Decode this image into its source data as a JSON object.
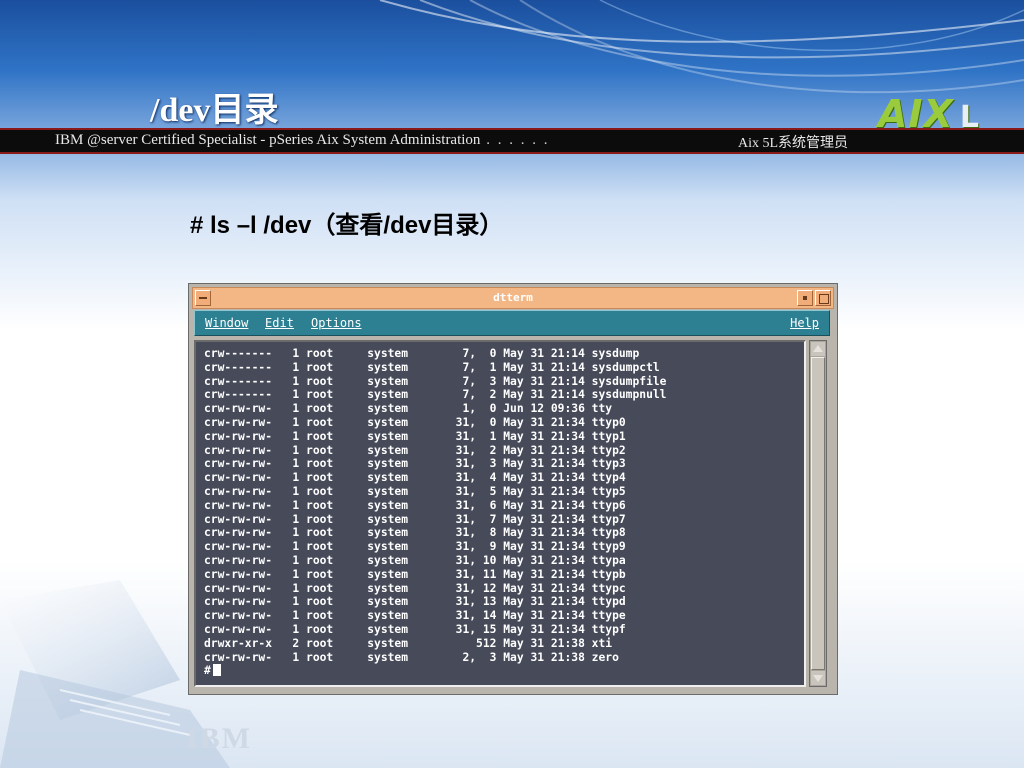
{
  "slide": {
    "title": "/dev目录",
    "banner_left": "IBM @server Certified Specialist - pSeries Aix System Administration",
    "banner_dots": " . . . . . .",
    "banner_right": "Aix 5L系统管理员",
    "logo_text": "AIX",
    "logo_suffix": "L",
    "command_heading": "# ls –l /dev（查看/dev目录）",
    "watermark": "IBM"
  },
  "window": {
    "title": "dtterm",
    "menu": {
      "window": "Window",
      "edit": "Edit",
      "options": "Options",
      "help": "Help"
    },
    "icons": {
      "window_menu": "window-menu-icon",
      "minimize": "minimize-icon",
      "maximize": "maximize-icon"
    }
  },
  "terminal": {
    "lines": [
      "crw-------   1 root     system        7,  0 May 31 21:14 sysdump",
      "crw-------   1 root     system        7,  1 May 31 21:14 sysdumpctl",
      "crw-------   1 root     system        7,  3 May 31 21:14 sysdumpfile",
      "crw-------   1 root     system        7,  2 May 31 21:14 sysdumpnull",
      "crw-rw-rw-   1 root     system        1,  0 Jun 12 09:36 tty",
      "crw-rw-rw-   1 root     system       31,  0 May 31 21:34 ttyp0",
      "crw-rw-rw-   1 root     system       31,  1 May 31 21:34 ttyp1",
      "crw-rw-rw-   1 root     system       31,  2 May 31 21:34 ttyp2",
      "crw-rw-rw-   1 root     system       31,  3 May 31 21:34 ttyp3",
      "crw-rw-rw-   1 root     system       31,  4 May 31 21:34 ttyp4",
      "crw-rw-rw-   1 root     system       31,  5 May 31 21:34 ttyp5",
      "crw-rw-rw-   1 root     system       31,  6 May 31 21:34 ttyp6",
      "crw-rw-rw-   1 root     system       31,  7 May 31 21:34 ttyp7",
      "crw-rw-rw-   1 root     system       31,  8 May 31 21:34 ttyp8",
      "crw-rw-rw-   1 root     system       31,  9 May 31 21:34 ttyp9",
      "crw-rw-rw-   1 root     system       31, 10 May 31 21:34 ttypa",
      "crw-rw-rw-   1 root     system       31, 11 May 31 21:34 ttypb",
      "crw-rw-rw-   1 root     system       31, 12 May 31 21:34 ttypc",
      "crw-rw-rw-   1 root     system       31, 13 May 31 21:34 ttypd",
      "crw-rw-rw-   1 root     system       31, 14 May 31 21:34 ttype",
      "crw-rw-rw-   1 root     system       31, 15 May 31 21:34 ttypf",
      "drwxr-xr-x   2 root     system          512 May 31 21:38 xti",
      "crw-rw-rw-   1 root     system        2,  3 May 31 21:38 zero"
    ],
    "prompt": "#"
  },
  "colors": {
    "titlebar": "#f3b786",
    "menubar": "#2d7f92",
    "terminal_bg": "#464a59",
    "terminal_fg": "#ffffff",
    "banner": "#0c0c0c"
  }
}
